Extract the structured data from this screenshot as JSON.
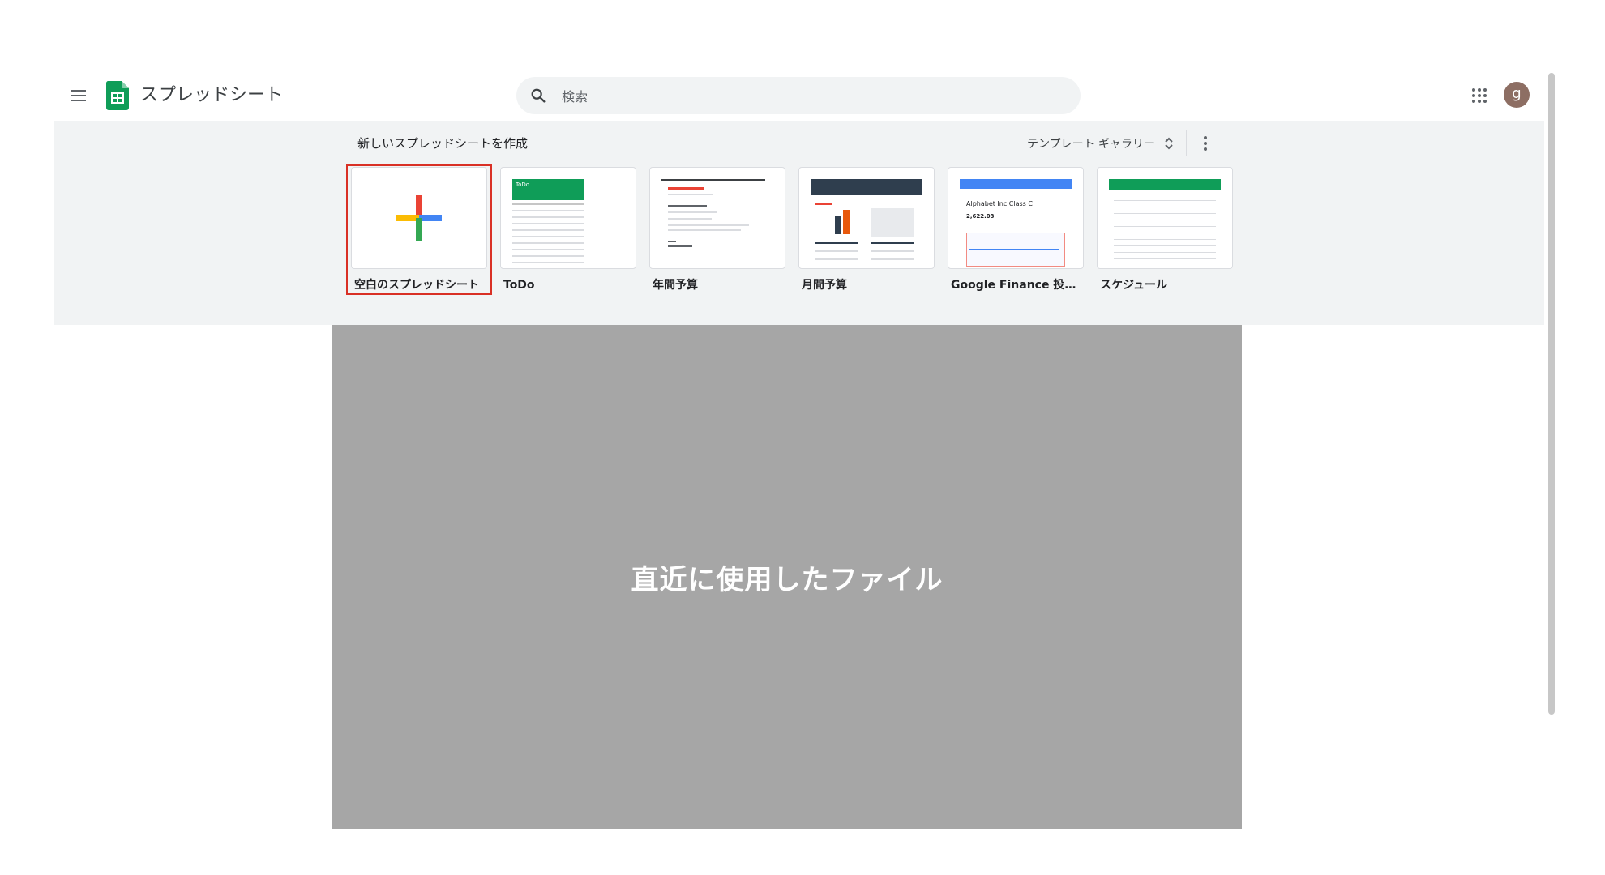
{
  "app": {
    "title": "スプレッドシート",
    "menu_icon": "hamburger-menu-icon",
    "logo_icon": "sheets-logo-icon",
    "brand_color": "#0f9d58"
  },
  "search": {
    "placeholder": "検索",
    "value": "",
    "icon": "search-icon"
  },
  "account": {
    "avatar_letter": "g",
    "avatar_color": "#8d6e63",
    "apps_icon": "google-apps-grid-icon"
  },
  "templates": {
    "section_title": "新しいスプレッドシートを作成",
    "gallery_label": "テンプレート ギャラリー",
    "gallery_icon": "unfold-more-icon",
    "more_icon": "more-vertical-icon",
    "items": [
      {
        "label": "空白のスプレッドシート",
        "icon": "plus-icon",
        "selected": true
      },
      {
        "label": "ToDo",
        "icon": "todo-thumbnail"
      },
      {
        "label": "年間予算",
        "icon": "annual-budget-thumbnail"
      },
      {
        "label": "月間予算",
        "icon": "monthly-budget-thumbnail"
      },
      {
        "label": "Google Finance 投資ト...",
        "icon": "finance-thumbnail",
        "thumb_heading": "Alphabet Inc Class C",
        "thumb_value": "2,622.03"
      },
      {
        "label": "スケジュール",
        "icon": "schedule-thumbnail"
      }
    ],
    "thumb_todo_title": "ToDo"
  },
  "recent": {
    "title": "直近に使用したファイル",
    "placeholder_color": "#a6a6a6"
  },
  "colors": {
    "accent_red": "#d93025",
    "search_bg": "#f1f3f4",
    "gallery_bg": "#f1f3f4"
  }
}
